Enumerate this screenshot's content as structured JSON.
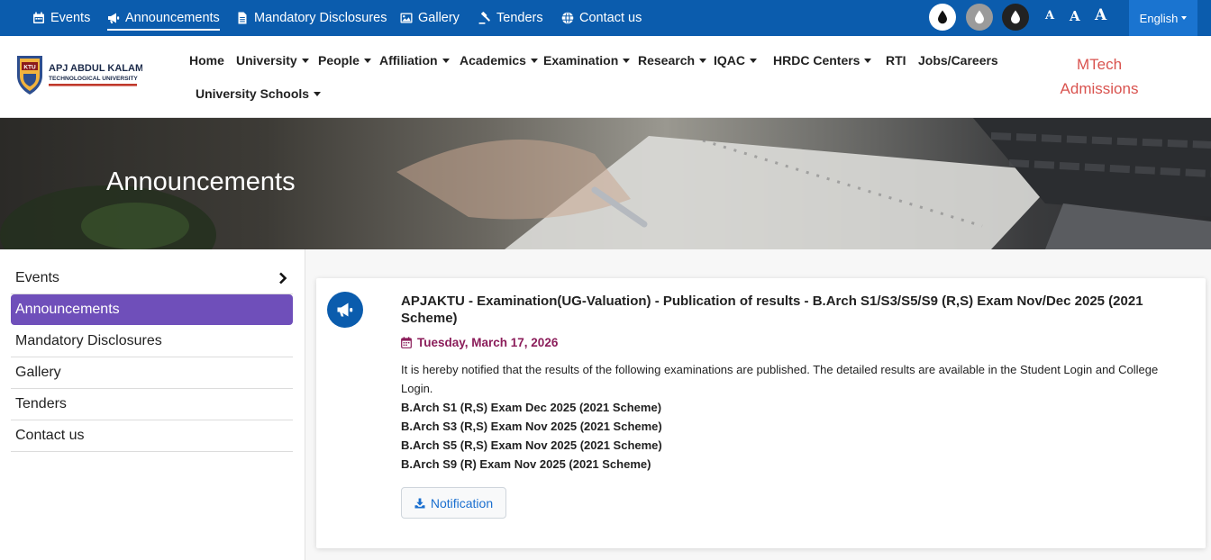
{
  "topbar": {
    "links": [
      {
        "label": "Events",
        "icon": "calendar-icon"
      },
      {
        "label": "Announcements",
        "icon": "megaphone-icon"
      },
      {
        "label": "Mandatory Disclosures",
        "icon": "document-icon"
      },
      {
        "label": "Gallery",
        "icon": "image-icon"
      },
      {
        "label": "Tenders",
        "icon": "gavel-icon"
      },
      {
        "label": "Contact us",
        "icon": "globe-icon"
      }
    ],
    "font_size_buttons": [
      "A",
      "A",
      "A"
    ],
    "language": "English",
    "colors": {
      "bar": "#0b5cad",
      "language_button": "#1a74d0"
    }
  },
  "nav": {
    "logo": {
      "name_line1": "APJ ABDUL KALAM",
      "name_line2": "TECHNOLOGICAL UNIVERSITY",
      "emblem_text": "KTU"
    },
    "items": [
      {
        "label": "Home"
      },
      {
        "label": "University"
      },
      {
        "label": "People"
      },
      {
        "label": "Affiliation"
      },
      {
        "label": "Academics"
      },
      {
        "label": "Examination"
      },
      {
        "label": "Research"
      },
      {
        "label": "IQAC"
      },
      {
        "label": "HRDC Centers"
      },
      {
        "label": "RTI"
      },
      {
        "label": "Jobs/Careers"
      },
      {
        "label": "University Schools"
      }
    ],
    "mtech_line1": "MTech",
    "mtech_line2": "Admissions"
  },
  "banner": {
    "title": "Announcements"
  },
  "sidebar": {
    "items": [
      {
        "label": "Events"
      },
      {
        "label": "Announcements"
      },
      {
        "label": "Mandatory Disclosures"
      },
      {
        "label": "Gallery"
      },
      {
        "label": "Tenders"
      },
      {
        "label": "Contact us"
      }
    ],
    "active_color": "#6f4fba"
  },
  "announcement": {
    "title": "APJAKTU - Examination(UG-Valuation) - Publication of results - B.Arch S1/S3/S5/S9 (R,S) Exam Nov/Dec 2025 (2021 Scheme)",
    "date": "Tuesday, March 17, 2026",
    "intro": "It is hereby notified that the results of the following examinations are published. The detailed results are available in the Student Login and College Login.",
    "lines": [
      "B.Arch S1 (R,S) Exam Dec 2025 (2021 Scheme)",
      "B.Arch S3 (R,S) Exam Nov 2025 (2021 Scheme)",
      "B.Arch S5 (R,S) Exam Nov 2025 (2021 Scheme)",
      "B.Arch S9 (R) Exam Nov 2025 (2021 Scheme)"
    ],
    "button_label": "Notification",
    "date_color": "#8b1d5a"
  }
}
